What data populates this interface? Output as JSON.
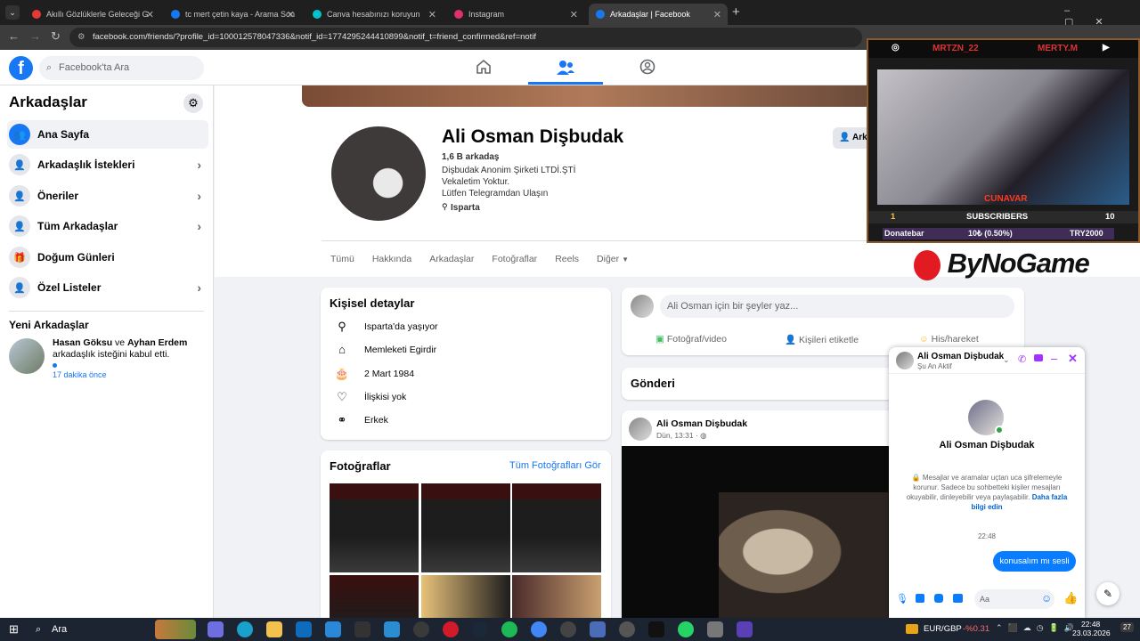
{
  "browser": {
    "tabs": [
      {
        "label": "Akıllı Gözlüklerle Geleceği G",
        "color": "#e53935"
      },
      {
        "label": "tc mert çetin kaya - Arama Son",
        "color": "#1877f2"
      },
      {
        "label": "Canva hesabınızı koruyun",
        "color": "#00c4cc"
      },
      {
        "label": "Instagram",
        "color": "#e1306c"
      },
      {
        "label": "Arkadaşlar | Facebook",
        "color": "#1877f2"
      }
    ],
    "url": "facebook.com/friends/?profile_id=100012578047336&notif_id=1774295244410899&notif_t=friend_confirmed&ref=notif"
  },
  "fb": {
    "search_placeholder": "Facebook'ta Ara",
    "sidebar": {
      "title": "Arkadaşlar",
      "items": [
        {
          "label": "Ana Sayfa",
          "icon": "friends-icon",
          "chevron": false
        },
        {
          "label": "Arkadaşlık İstekleri",
          "icon": "friend-request-icon",
          "chevron": true
        },
        {
          "label": "Öneriler",
          "icon": "suggestion-icon",
          "chevron": true
        },
        {
          "label": "Tüm Arkadaşlar",
          "icon": "all-friends-icon",
          "chevron": true
        },
        {
          "label": "Doğum Günleri",
          "icon": "gift-icon",
          "chevron": false
        },
        {
          "label": "Özel Listeler",
          "icon": "list-icon",
          "chevron": true
        }
      ],
      "new_friends_title": "Yeni Arkadaşlar",
      "notif_name1": "Hasan Göksu",
      "notif_and": "ve",
      "notif_name2": "Ayhan Erdem",
      "notif_text": "arkadaşlık isteğini kabul etti.",
      "notif_time": "17 dakika önce"
    },
    "profile": {
      "name": "Ali Osman Dişbudak",
      "friends": "1,6 B arkadaş",
      "bio1": "Dişbudak Anonim Şirketi LTDİ.ŞTİ",
      "bio2": "Vekaletim Yoktur.",
      "bio3": "Lütfen Telegramdan Ulaşın",
      "location": "Isparta",
      "friend_button": "Arka",
      "tabs": [
        "Tümü",
        "Hakkında",
        "Arkadaşlar",
        "Fotoğraflar",
        "Reels",
        "Diğer"
      ]
    },
    "details": {
      "title": "Kişisel detaylar",
      "rows": [
        {
          "icon": "location-icon",
          "text": "Isparta'da yaşıyor"
        },
        {
          "icon": "home-icon",
          "text": "Memleketi Egirdir"
        },
        {
          "icon": "cake-icon",
          "text": "2 Mart 1984"
        },
        {
          "icon": "relationship-icon",
          "text": "İlişkisi yok"
        },
        {
          "icon": "gender-icon",
          "text": "Erkek"
        }
      ]
    },
    "photos": {
      "title": "Fotoğraflar",
      "see_all": "Tüm Fotoğrafları Gör"
    },
    "composer": {
      "placeholder": "Ali Osman için bir şeyler yaz...",
      "photo": "Fotoğraf/video",
      "tag": "Kişileri etiketle",
      "feeling": "His/hareket"
    },
    "posts": {
      "title": "Gönderi",
      "author": "Ali Osman Dişbudak",
      "time": "Dün, 13:31 · ◍"
    }
  },
  "chat": {
    "name": "Ali Osman Dişbudak",
    "status": "Şu An Aktif",
    "center_name": "Ali Osman Dişbudak",
    "e2e": "Mesajlar ve aramalar uçtan uca şifrelemeyle korunur. Sadece bu sohbetteki kişiler mesajları okuyabilir, dinleyebilir veya paylaşabilir.",
    "e2e_link": "Daha fazla bilgi edin",
    "time": "22:48",
    "message": "konusalım mı sesli",
    "input_placeholder": "Aa"
  },
  "stream": {
    "top_left": "MRTZN_22",
    "top_right": "MERTY.M",
    "cam_label": "CUNAVAR",
    "sub_left": "1",
    "sub_label": "SUBSCRIBERS",
    "sub_right": "10",
    "donate_label": "Donatebar",
    "donate_mid": "10₺ (0.50%)",
    "donate_right": "TRY2000",
    "brand": "ByNoGame"
  },
  "taskbar": {
    "search": "Ara",
    "currency": "EUR/GBP",
    "currency_change": "-%0.31",
    "time": "22:48",
    "date": "23.03.2026",
    "notif_count": "27"
  }
}
